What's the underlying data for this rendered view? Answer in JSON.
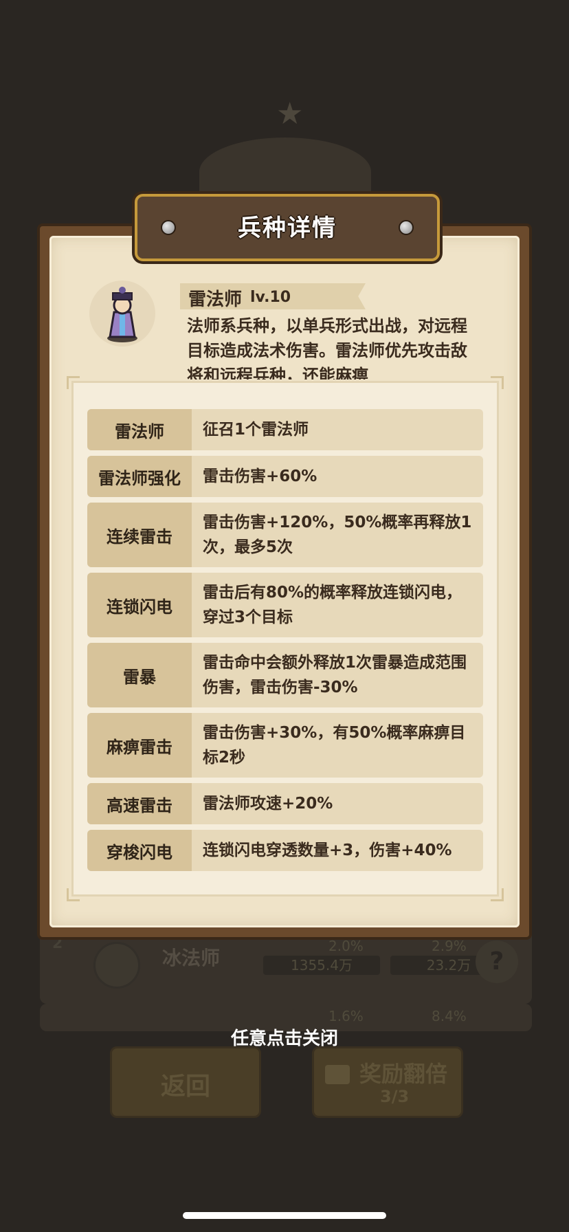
{
  "background": {
    "rows": [
      {
        "rank": "2",
        "name": "冰法师",
        "stat_a": "2.0%",
        "value_a": "1355.4万",
        "stat_b": "2.9%",
        "value_b": "23.2万"
      },
      {
        "rank": "1",
        "name": "",
        "stat_a": "1.6%",
        "value_a": "",
        "stat_b": "8.4%",
        "value_b": ""
      }
    ],
    "back_button": "返回",
    "reward_button": "奖励翻倍",
    "reward_count": "3/3",
    "help_icon_glyph": "?"
  },
  "modal": {
    "title": "兵种详情",
    "unit": {
      "name": "雷法师",
      "level": "lv.10",
      "description": "法师系兵种，以单兵形式出战，对远程目标造成法术伤害。雷法师优先攻击敌将和远程兵种，还能麻痹"
    },
    "skills": [
      {
        "name": "雷法师",
        "desc": "征召1个雷法师"
      },
      {
        "name": "雷法师强化",
        "desc": "雷击伤害+60%"
      },
      {
        "name": "连续雷击",
        "desc": "雷击伤害+120%，50%概率再释放1次，最多5次"
      },
      {
        "name": "连锁闪电",
        "desc": "雷击后有80%的概率释放连锁闪电，穿过3个目标"
      },
      {
        "name": "雷暴",
        "desc": "雷击命中会额外释放1次雷暴造成范围伤害，雷击伤害-30%"
      },
      {
        "name": "麻痹雷击",
        "desc": "雷击伤害+30%，有50%概率麻痹目标2秒"
      },
      {
        "name": "高速雷击",
        "desc": "雷法师攻速+20%"
      },
      {
        "name": "穿梭闪电",
        "desc": "连锁闪电穿透数量+3，伤害+40%"
      }
    ]
  },
  "hint": "任意点击关闭",
  "colors": {
    "overlay": "#2a2622",
    "frame": "#6b4a2c",
    "paper": "#efe3c8",
    "skill_name_bg": "#d7c39a",
    "skill_desc_bg": "#e7d9ba",
    "title_plate": "#5a4431",
    "text": "#3a2b1e"
  }
}
